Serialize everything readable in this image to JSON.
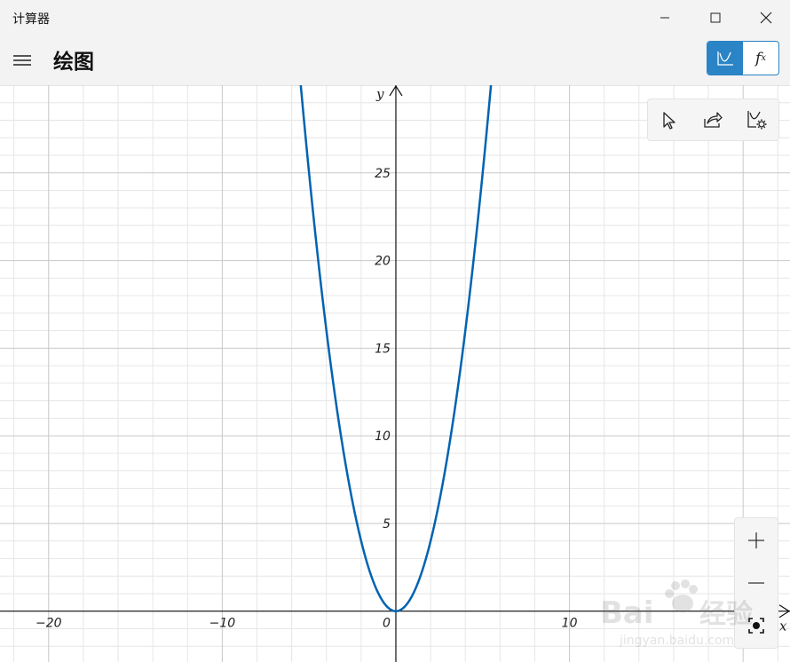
{
  "window": {
    "title": "计算器"
  },
  "header": {
    "title": "绘图",
    "mode_graph_icon": "graph-icon",
    "mode_func_label": "f",
    "mode_func_sub": "x",
    "active_mode_color": "#2a84c6"
  },
  "tools": {
    "select_icon": "cursor-icon",
    "share_icon": "share-icon",
    "settings_icon": "graph-settings-icon"
  },
  "zoom": {
    "zoom_in_icon": "plus-icon",
    "zoom_out_icon": "minus-icon",
    "reset_icon": "fit-view-icon"
  },
  "chart_data": {
    "type": "line",
    "function": "y = x^2",
    "xlim": [
      -22.8,
      22.7
    ],
    "ylim": [
      -2.9,
      30.0
    ],
    "grid": true,
    "line_color": "#0063b1",
    "xlabel": "x",
    "ylabel": "y",
    "x_ticks": [
      {
        "value": -20,
        "label": "−20"
      },
      {
        "value": -10,
        "label": "−10"
      },
      {
        "value": 10,
        "label": "10"
      }
    ],
    "y_ticks": [
      {
        "value": 5,
        "label": "5"
      },
      {
        "value": 10,
        "label": "10"
      },
      {
        "value": 15,
        "label": "15"
      },
      {
        "value": 20,
        "label": "20"
      },
      {
        "value": 25,
        "label": "25"
      }
    ],
    "origin_label": "0"
  }
}
